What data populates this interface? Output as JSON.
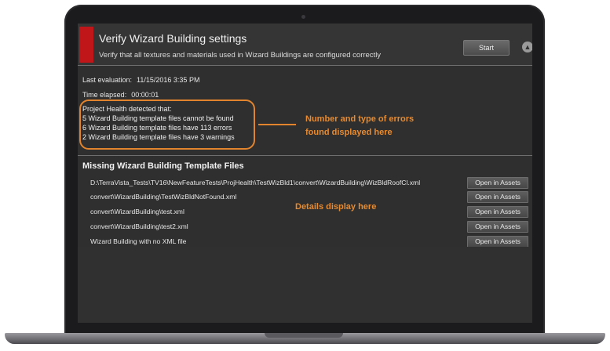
{
  "header": {
    "title": "Verify Wizard Building settings",
    "subtitle": "Verify that all textures and materials used in Wizard Buildings are configured correctly",
    "start_label": "Start",
    "accent_color": "#c0161a"
  },
  "evaluation": {
    "last_label": "Last evaluation:",
    "last_value": "11/15/2016 3:35 PM",
    "elapsed_label": "Time elapsed:",
    "elapsed_value": "00:00:01"
  },
  "health": {
    "lines": [
      "Project Health detected that:",
      "5 Wizard Building template files cannot be found",
      "6 Wizard Building template files have 113 errors",
      "2 Wizard Building template files have 3 warnings"
    ]
  },
  "annotations": {
    "errors_line1": "Number and type of errors",
    "errors_line2": "found displayed here",
    "details": "Details display here",
    "color": "#e88a2e"
  },
  "missing": {
    "title": "Missing Wizard Building Template Files",
    "button_label": "Open in Assets",
    "files": [
      "D:\\TerraVista_Tests\\TV16\\NewFeatureTests\\ProjHealth\\TestWizBld1\\convert\\WizardBuilding\\WizBldRoofCl.xml",
      "convert\\WizardBuilding\\TestWizBldNotFound.xml",
      "convert\\WizardBuilding\\test.xml",
      "convert\\WizardBuilding\\test2.xml",
      "Wizard Building with no XML file"
    ]
  },
  "icons": {
    "collapse": "chevron-up-icon"
  }
}
